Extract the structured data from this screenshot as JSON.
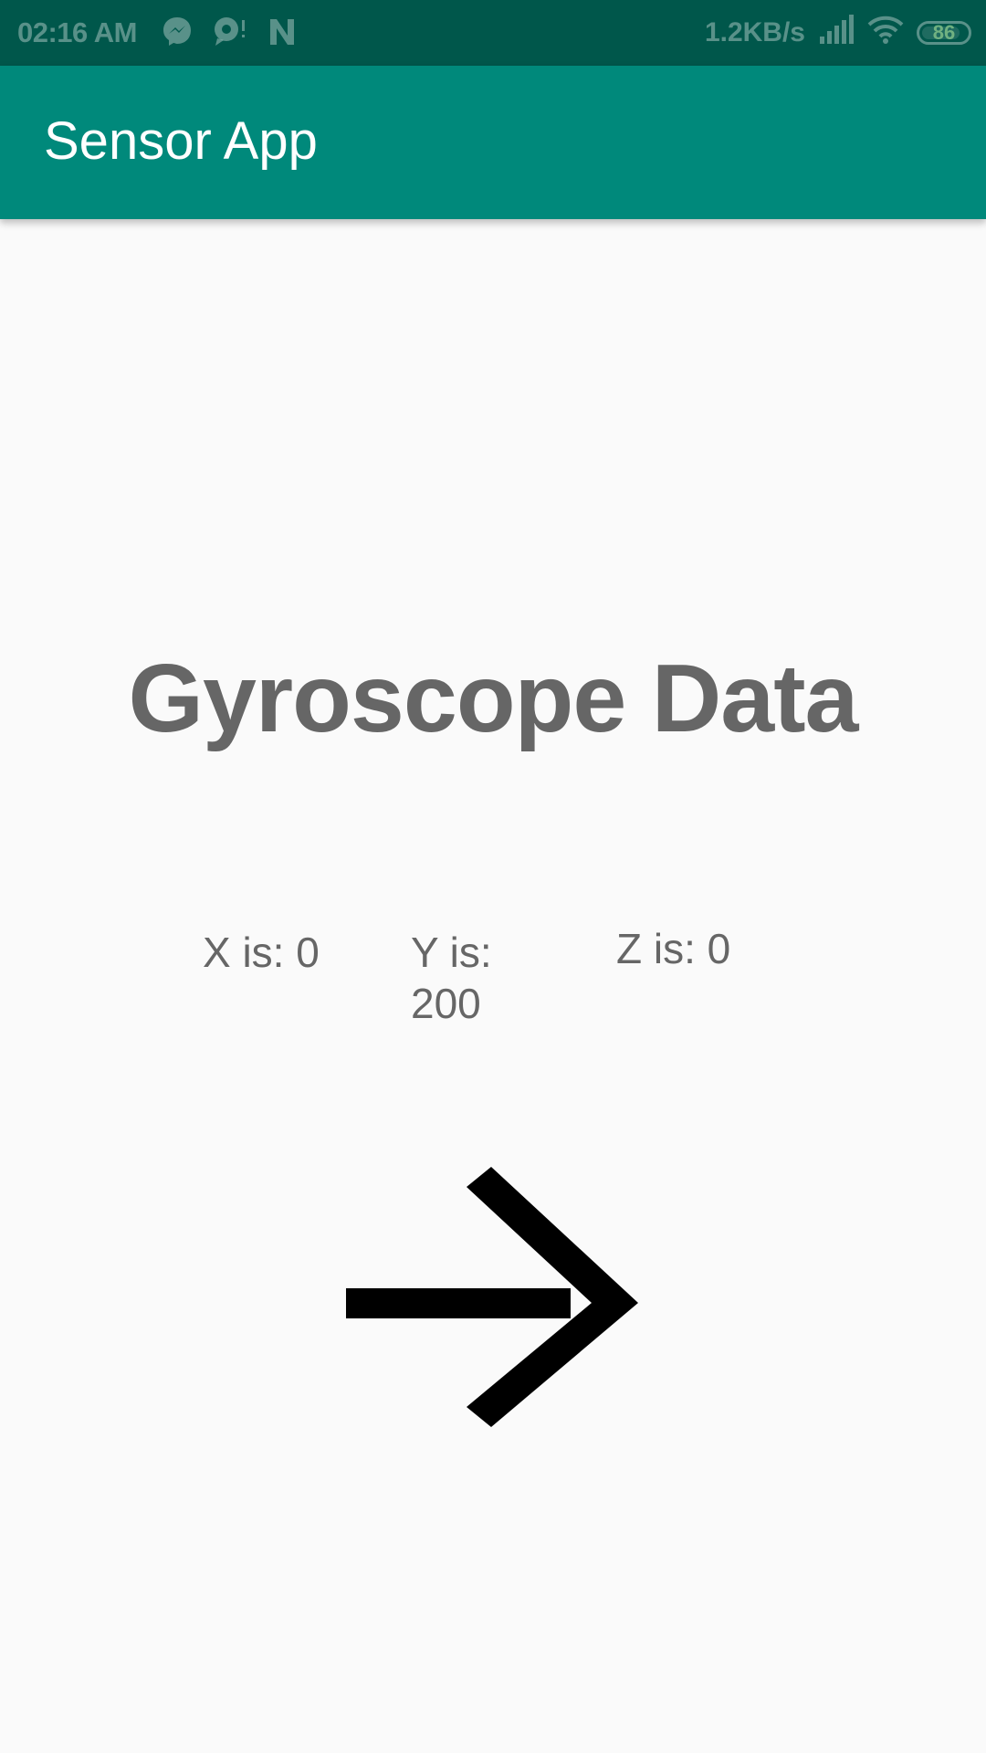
{
  "status_bar": {
    "time": "02:16 AM",
    "network_speed": "1.2KB/s",
    "battery_level": "86",
    "battery_fraction": 0.86,
    "icons": [
      "messenger-icon",
      "chat-bubble-icon",
      "n-app-icon",
      "signal-icon",
      "wifi-icon",
      "battery-icon"
    ]
  },
  "app_bar": {
    "title": "Sensor App",
    "color": "#00897b"
  },
  "main": {
    "heading": "Gyroscope Data",
    "readings": {
      "x": "X is: 0",
      "y": "Y is: 200",
      "z": "Z is: 0"
    },
    "direction_icon": "arrow-right-icon"
  },
  "colors": {
    "status_bar": "#00574b",
    "primary": "#00897b",
    "background": "#fafafa",
    "text": "#666666",
    "arrow": "#000000"
  }
}
